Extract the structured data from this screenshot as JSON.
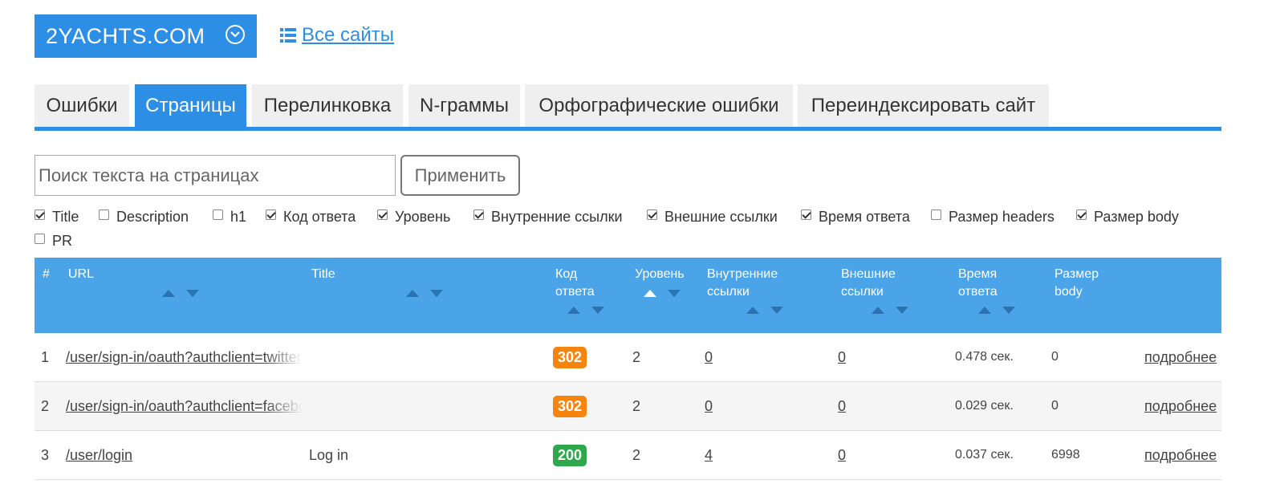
{
  "header": {
    "site_name": "2YACHTS.COM",
    "all_sites_label": "Все сайты"
  },
  "tabs": [
    {
      "label": "Ошибки",
      "active": false
    },
    {
      "label": "Страницы",
      "active": true
    },
    {
      "label": "Перелинковка",
      "active": false
    },
    {
      "label": "N-граммы",
      "active": false
    },
    {
      "label": "Орфографические ошибки",
      "active": false
    },
    {
      "label": "Переиндексировать сайт",
      "active": false
    }
  ],
  "search": {
    "placeholder": "Поиск текста на страницах",
    "value": "",
    "apply_label": "Применить"
  },
  "columns_toggle": [
    {
      "label": "Title",
      "checked": true
    },
    {
      "label": "Description",
      "checked": false
    },
    {
      "label": "h1",
      "checked": false
    },
    {
      "label": "Код ответа",
      "checked": true
    },
    {
      "label": "Уровень",
      "checked": true
    },
    {
      "label": "Внутренние ссылки",
      "checked": true
    },
    {
      "label": "Внешние ссылки",
      "checked": true
    },
    {
      "label": "Время ответа",
      "checked": true
    },
    {
      "label": "Размер headers",
      "checked": false
    },
    {
      "label": "Размер body",
      "checked": true
    },
    {
      "label": "PR",
      "checked": false
    }
  ],
  "table": {
    "headers": {
      "num": "#",
      "url": "URL",
      "title": "Title",
      "code_1": "Код",
      "code_2": "ответа",
      "level": "Уровень",
      "internal_1": "Внутренние",
      "internal_2": "ссылки",
      "external_1": "Внешние",
      "external_2": "ссылки",
      "time_1": "Время",
      "time_2": "ответа",
      "body_1": "Размер",
      "body_2": "body"
    },
    "rows": [
      {
        "num": "1",
        "url": "/user/sign-in/oauth?authclient=twitter",
        "title": "",
        "code": "302",
        "code_color": "#f5850f",
        "level": "2",
        "internal": "0",
        "external": "0",
        "time": "0.478 сек.",
        "body": "0",
        "more": "подробнее"
      },
      {
        "num": "2",
        "url": "/user/sign-in/oauth?authclient=facebook",
        "title": "",
        "code": "302",
        "code_color": "#f5850f",
        "level": "2",
        "internal": "0",
        "external": "0",
        "time": "0.029 сек.",
        "body": "0",
        "more": "подробнее"
      },
      {
        "num": "3",
        "url": "/user/login",
        "title": "Log in",
        "code": "200",
        "code_color": "#2ea84a",
        "level": "2",
        "internal": "4",
        "external": "0",
        "time": "0.037 сек.",
        "body": "6998",
        "more": "подробнее"
      }
    ]
  },
  "colors": {
    "accent": "#2d8ee6",
    "table_header": "#4ba3e8"
  }
}
